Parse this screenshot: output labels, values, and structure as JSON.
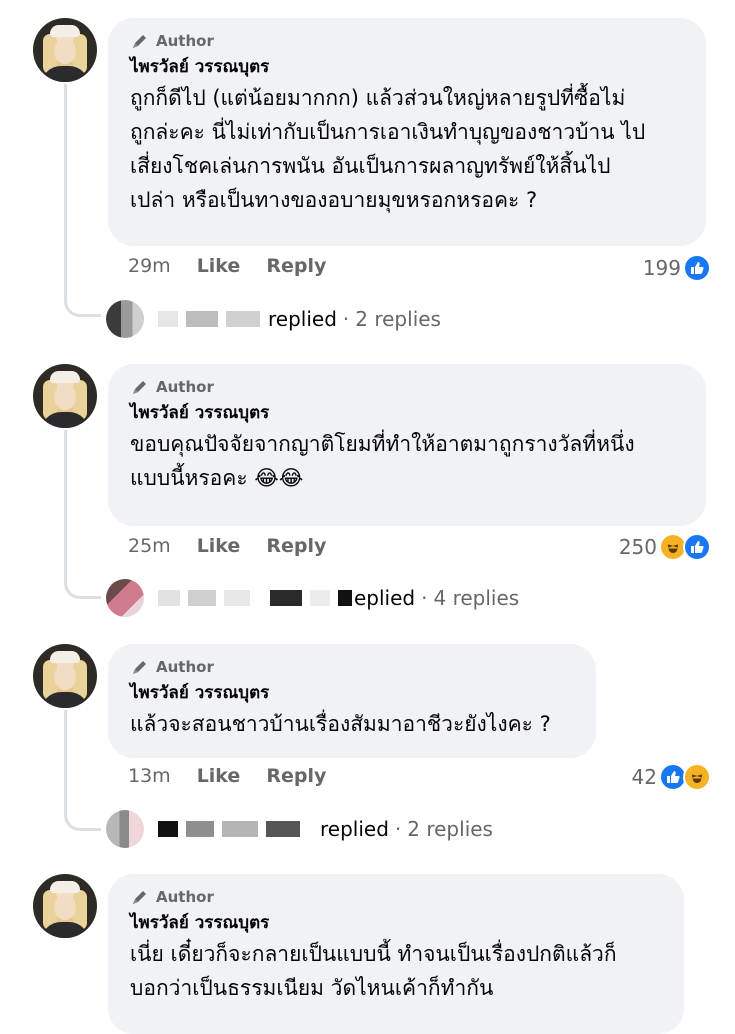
{
  "comments": [
    {
      "author_tag": "Author",
      "name": "ไพรวัลย์ วรรณบุตร",
      "text": "ถูกก็ดีไป (แต่น้อยมากกก) แล้วส่วนใหญ่หลายรูปที่ซื้อไม่\nถูกล่ะคะ นี่ไม่เท่ากับเป็นการเอาเงินทำบุญของชาวบ้าน ไป\nเสี่ยงโชคเล่นการพนัน อันเป็นการผลาญทรัพย์ให้สิ้นไป\nเปล่า หรือเป็นทางของอบายมุขหรอกหรอคะ ?",
      "time": "29m",
      "like_label": "Like",
      "reply_label": "Reply",
      "reaction_count": "199",
      "reactions": [
        "like-icon"
      ],
      "replied_text": "replied",
      "replies_count": "2 replies"
    },
    {
      "author_tag": "Author",
      "name": "ไพรวัลย์ วรรณบุตร",
      "text": "ขอบคุณปัจจัยจากญาติโยมที่ทำให้อาตมาถูกรางวัลที่หนึ่ง\nแบบนี้หรอคะ 😂😂",
      "time": "25m",
      "like_label": "Like",
      "reply_label": "Reply",
      "reaction_count": "250",
      "reactions": [
        "haha-icon",
        "like-icon"
      ],
      "replied_text": "eplied",
      "replies_count": "4 replies"
    },
    {
      "author_tag": "Author",
      "name": "ไพรวัลย์ วรรณบุตร",
      "text": "แล้วจะสอนชาวบ้านเรื่องสัมมาอาชีวะยังไงคะ ?",
      "time": "13m",
      "like_label": "Like",
      "reply_label": "Reply",
      "reaction_count": "42",
      "reactions": [
        "like-icon",
        "haha-icon"
      ],
      "replied_text": "replied",
      "replies_count": "2 replies"
    },
    {
      "author_tag": "Author",
      "name": "ไพรวัลย์ วรรณบุตร",
      "text": "เนี่ย เดี๋ยวก็จะกลายเป็นแบบนี้ ทำจนเป็นเรื่องปกติแล้วก็\nบอกว่าเป็นธรรมเนียม วัดไหนเค้าก็ทำกัน"
    }
  ],
  "reply_separator": "·",
  "colors": {
    "bubble": "#f0f2f5",
    "like": "#1877f2",
    "haha": "#f7b125",
    "meta": "#65676b"
  }
}
